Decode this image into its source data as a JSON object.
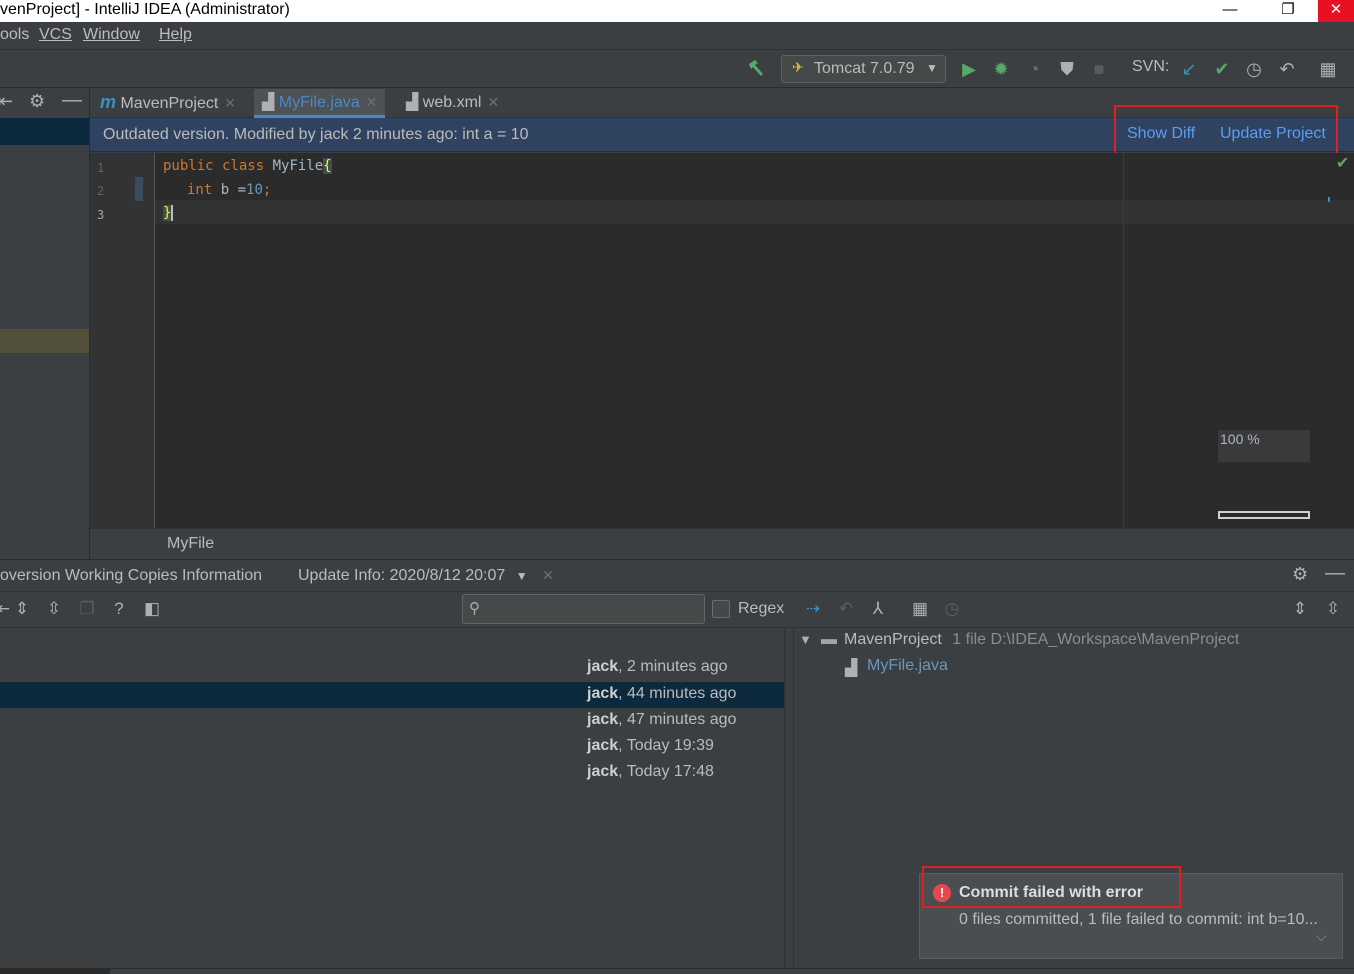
{
  "window": {
    "title": "venProject] - IntelliJ IDEA (Administrator)",
    "minimize": "—",
    "restore": "❐",
    "close": "✕"
  },
  "menu": {
    "tools": "ools",
    "vcs": "VCS",
    "window": "Window",
    "help": "Help"
  },
  "toolbar": {
    "run_config": "Tomcat 7.0.79",
    "svn_label": "SVN:"
  },
  "tabs": [
    {
      "label": "MavenProject"
    },
    {
      "label": "MyFile.java"
    },
    {
      "label": "web.xml"
    }
  ],
  "banner": {
    "message": "Outdated version. Modified by jack 2 minutes ago: int a = 10",
    "show_diff": "Show Diff",
    "update_project": "Update Project"
  },
  "editor": {
    "line_numbers": [
      "1",
      "2",
      "3"
    ],
    "lines": {
      "l1_kw": "public class",
      "l1_name": " MyFile",
      "l1_brace": "{",
      "l2_kw": "int",
      "l2_rest": " b =",
      "l2_num": "10",
      "l2_end": ";",
      "l3": "}"
    },
    "zoom": "100 %"
  },
  "breadcrumb": "MyFile",
  "panel": {
    "tab1": "oversion Working Copies Information",
    "tab2": "Update Info: 2020/8/12 20:07",
    "regex": "Regex",
    "search_placeholder": ""
  },
  "history": [
    {
      "author": "jack",
      "when": ", 2 minutes ago"
    },
    {
      "author": "jack",
      "when": ", 44 minutes ago"
    },
    {
      "author": "jack",
      "when": ", 47 minutes ago"
    },
    {
      "author": "jack",
      "when": ", Today 19:39"
    },
    {
      "author": "jack",
      "when": ", Today 17:48"
    }
  ],
  "tree": {
    "root": "MavenProject",
    "root_meta": "1 file  D:\\IDEA_Workspace\\MavenProject",
    "child": "MyFile.java"
  },
  "notification": {
    "title": "Commit failed with error",
    "body": "0 files committed, 1 file failed to commit: int b=10..."
  },
  "colors": {
    "accent": "#4a88c7",
    "link": "#589df6",
    "error": "#e5484d",
    "banner_bg": "#2f4360",
    "highlight_box": "#e02020"
  }
}
